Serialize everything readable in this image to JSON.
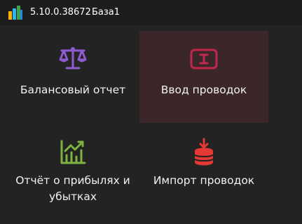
{
  "titlebar": {
    "version": "5.10.0.38672",
    "database": "База1",
    "app_icon": "app-logo-icon"
  },
  "tiles": [
    {
      "label": "Балансовый отчет",
      "icon": "scales-icon",
      "color": "#8e5bd0",
      "selected": false
    },
    {
      "label": "Ввод проводок",
      "icon": "text-input-icon",
      "color": "#c2284e",
      "selected": true
    },
    {
      "label": "Отчёт о прибылях и убытках",
      "icon": "profit-chart-icon",
      "color": "#7cb342",
      "selected": false
    },
    {
      "label": "Импорт проводок",
      "icon": "database-import-icon",
      "color": "#e53935",
      "selected": false
    }
  ],
  "colors": {
    "background": "#232323",
    "titlebar": "#1d1d1d",
    "selected_tile": "#3b2629"
  }
}
